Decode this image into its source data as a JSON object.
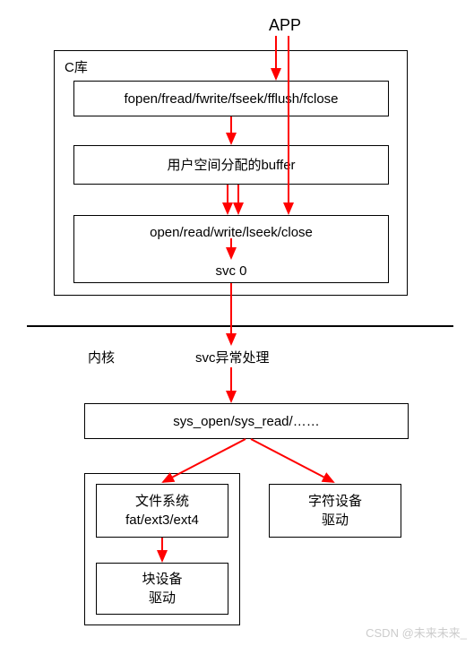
{
  "labels": {
    "app": "APP",
    "clib": "C库",
    "kernel": "内核",
    "svc_handler": "svc异常处理"
  },
  "boxes": {
    "clib_funcs": "fopen/fread/fwrite/fseek/fflush/fclose",
    "user_buffer": "用户空间分配的buffer",
    "syscalls_top": "open/read/write/lseek/close",
    "svc0": "svc 0",
    "sys_funcs": "sys_open/sys_read/……",
    "fs_line1": "文件系统",
    "fs_line2": "fat/ext3/ext4",
    "chardev_line1": "字符设备",
    "chardev_line2": "驱动",
    "blockdev_line1": "块设备",
    "blockdev_line2": "驱动"
  },
  "watermark": "CSDN @未来未来_",
  "chart_data": {
    "type": "diagram",
    "title": "Linux file I/O call stack from APP to drivers",
    "nodes": [
      {
        "id": "app",
        "label": "APP"
      },
      {
        "id": "clib_group",
        "label": "C库",
        "children": [
          "clib_funcs",
          "user_buffer",
          "syscalls"
        ]
      },
      {
        "id": "clib_funcs",
        "label": "fopen/fread/fwrite/fseek/fflush/fclose"
      },
      {
        "id": "user_buffer",
        "label": "用户空间分配的buffer"
      },
      {
        "id": "syscalls",
        "label": "open/read/write/lseek/close → svc 0"
      },
      {
        "id": "divider",
        "label": "user/kernel boundary"
      },
      {
        "id": "svc_handler",
        "label": "svc异常处理"
      },
      {
        "id": "sys_funcs",
        "label": "sys_open/sys_read/……"
      },
      {
        "id": "fs",
        "label": "文件系统 fat/ext3/ext4"
      },
      {
        "id": "chardev",
        "label": "字符设备 驱动"
      },
      {
        "id": "blockdev",
        "label": "块设备 驱动"
      }
    ],
    "edges": [
      {
        "from": "app",
        "to": "clib_funcs"
      },
      {
        "from": "app",
        "to": "syscalls",
        "note": "direct path bypassing buffered C lib"
      },
      {
        "from": "clib_funcs",
        "to": "user_buffer"
      },
      {
        "from": "user_buffer",
        "to": "syscalls"
      },
      {
        "from": "syscalls",
        "to": "svc_handler",
        "via": "svc 0"
      },
      {
        "from": "svc_handler",
        "to": "sys_funcs"
      },
      {
        "from": "sys_funcs",
        "to": "fs"
      },
      {
        "from": "sys_funcs",
        "to": "chardev"
      },
      {
        "from": "fs",
        "to": "blockdev"
      }
    ]
  }
}
